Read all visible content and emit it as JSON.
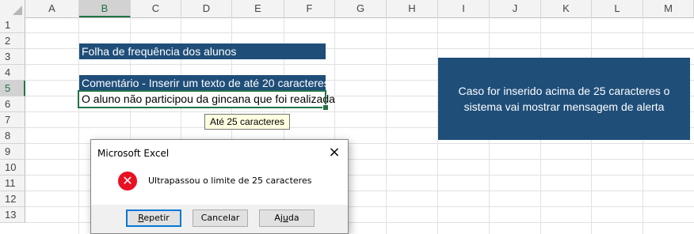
{
  "columns": [
    "A",
    "B",
    "C",
    "D",
    "E",
    "F",
    "G",
    "H",
    "I",
    "J",
    "K",
    "L",
    "M"
  ],
  "rows": [
    "1",
    "2",
    "3",
    "4",
    "5",
    "6",
    "7",
    "8",
    "9",
    "10",
    "11",
    "12",
    "13"
  ],
  "selected_column": "B",
  "selected_row": "5",
  "cells": {
    "b2": "Folha de frequência dos alunos",
    "b4": "Comentário - Inserir um texto de até 20 caracteres",
    "b5": "O aluno não participou da gincana que foi realizada"
  },
  "tooltip": "Até 25 caracteres",
  "note_box": "Caso for inserido acima de 25 caracteres o sistema vai mostrar mensagem de alerta",
  "dialog": {
    "title": "Microsoft Excel",
    "close_icon": "×",
    "error_icon": "✕",
    "message": "Ultrapassou o limite de 25 caracteres",
    "buttons": {
      "retry_u": "R",
      "retry_rest": "epetir",
      "cancel": "Cancelar",
      "help_pre": "Aj",
      "help_u": "u",
      "help_post": "da"
    }
  },
  "colors": {
    "band": "#1f4e79",
    "selection": "#217346",
    "error": "#e81123"
  }
}
